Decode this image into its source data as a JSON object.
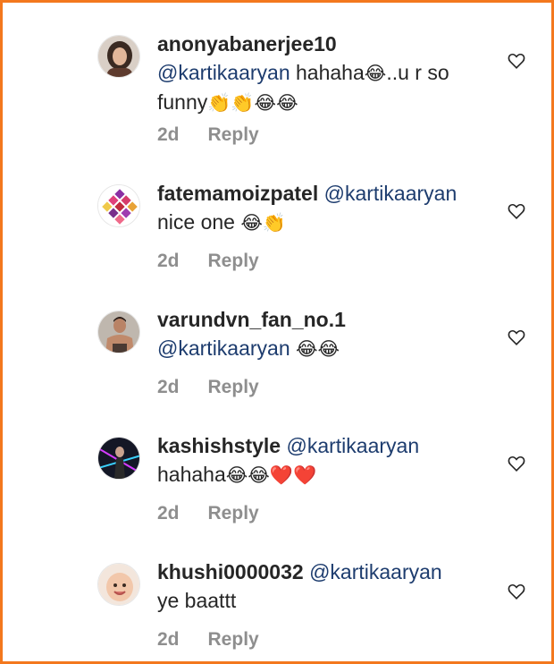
{
  "comments": [
    {
      "username": "anonyabanerjee10",
      "mention": "@kartikaaryan",
      "text": " hahaha",
      "text_tail": "..u r so funny",
      "emoji_a": "😂",
      "emoji_b": "👏👏😂😂",
      "time": "2d",
      "reply": "Reply",
      "avatar": "avatar-woman-icon"
    },
    {
      "username": "fatemamoizpatel",
      "mention": "@kartikaaryan",
      "text": "nice one ",
      "emoji": "😂👏",
      "time": "2d",
      "reply": "Reply",
      "avatar": "avatar-colorful-grid-icon"
    },
    {
      "username": "varundvn_fan_no.1",
      "mention": "@kartikaaryan",
      "text": " ",
      "emoji": "😂😂",
      "time": "2d",
      "reply": "Reply",
      "avatar": "avatar-man-icon"
    },
    {
      "username": "kashishstyle",
      "mention": "@kartikaaryan",
      "text": "hahaha",
      "emoji": "😂😂❤️❤️",
      "time": "2d",
      "reply": "Reply",
      "avatar": "avatar-dark-neon-icon"
    },
    {
      "username": "khushi0000032",
      "mention": "@kartikaaryan",
      "text": "ye baattt",
      "time": "2d",
      "reply": "Reply",
      "avatar": "avatar-baby-icon"
    }
  ],
  "colors": {
    "border": "#f3781e",
    "text": "#262626",
    "mention": "#1d3c6e",
    "meta": "#8e8e8e"
  }
}
